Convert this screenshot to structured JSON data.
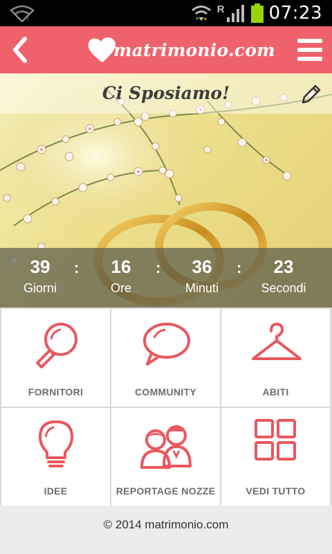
{
  "status_bar": {
    "time": "07:23",
    "network_indicator": "R",
    "icons": [
      "wifi-no-signal-icon",
      "wifi-icon",
      "signal-icon",
      "battery-icon"
    ]
  },
  "app_bar": {
    "back_icon": "chevron-left-icon",
    "logo_text": "matrimonio.com",
    "menu_icon": "hamburger-menu-icon",
    "color": "#f0626b"
  },
  "hero": {
    "title": "Ci Sposiamo!",
    "edit_icon": "pencil-icon"
  },
  "countdown": {
    "items": [
      {
        "value": "39",
        "label": "Giorni"
      },
      {
        "value": "16",
        "label": "Ore"
      },
      {
        "value": "36",
        "label": "Minuti"
      },
      {
        "value": "23",
        "label": "Secondi"
      }
    ],
    "separator": ":"
  },
  "menu_grid": [
    {
      "label": "FORNITORI",
      "icon": "magnifier-icon"
    },
    {
      "label": "COMMUNITY",
      "icon": "speech-bubble-icon"
    },
    {
      "label": "ABITI",
      "icon": "hanger-icon"
    },
    {
      "label": "IDEE",
      "icon": "light-bulb-icon"
    },
    {
      "label": "REPORTAGE NOZZE",
      "icon": "couple-icon"
    },
    {
      "label": "VEDI TUTTO",
      "icon": "grid-icon"
    }
  ],
  "footer": {
    "copyright": "© 2014 matrimonio.com"
  },
  "colors": {
    "accent": "#f0626b",
    "icon": "#e9575f",
    "label": "#6c6c6c"
  }
}
